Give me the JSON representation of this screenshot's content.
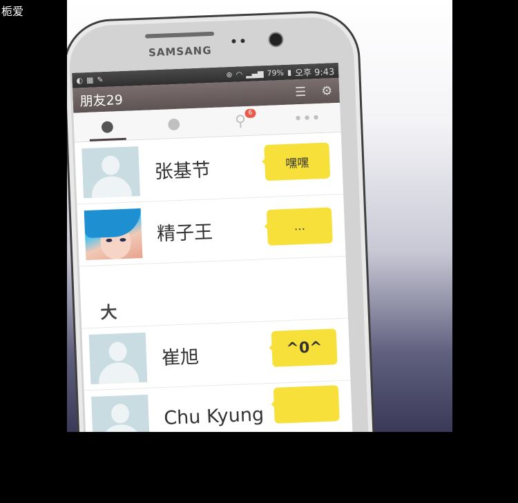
{
  "watermark": "栀爱",
  "device": {
    "brand": "SAMSANG"
  },
  "status_bar": {
    "battery": "79%",
    "time": "오후 9:43"
  },
  "app_bar": {
    "title": "朋友29"
  },
  "tabs": [
    {
      "name": "friends",
      "icon": "person-icon",
      "active": true
    },
    {
      "name": "chats",
      "icon": "chat-bubble-icon",
      "active": false
    },
    {
      "name": "search",
      "icon": "search-icon",
      "badge": "6",
      "active": false
    },
    {
      "name": "more",
      "icon": "more-dots-icon",
      "active": false
    }
  ],
  "friends": [
    {
      "name": "张基节",
      "status": "嘿嘿",
      "avatar": "default"
    },
    {
      "name": "精子王",
      "status": "...",
      "avatar": "photo"
    }
  ],
  "section_header": "大",
  "friends_section2": [
    {
      "name": "崔旭",
      "status": "^0^",
      "avatar": "default"
    },
    {
      "name": "Chu Kyung",
      "status": "",
      "avatar": "default"
    }
  ],
  "colors": {
    "bubble": "#f8e03a",
    "app_bar": "#6e6262",
    "badge": "#e85b4b"
  }
}
